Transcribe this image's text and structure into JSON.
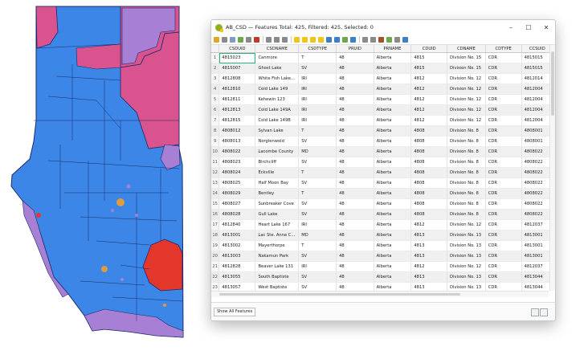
{
  "window": {
    "title": "AB_CSD — Features Total: 425, Filtered: 425, Selected: 0",
    "minimize": "–",
    "maximize": "☐",
    "close": "✕"
  },
  "toolbar": {
    "icons": [
      "pencil-icon",
      "edit-icon",
      "save-icon",
      "reload-icon",
      "add-feature-icon",
      "delete-icon",
      "cut-icon",
      "copy-icon",
      "paste-icon",
      "select-expression-icon",
      "select-all-icon",
      "invert-selection-icon",
      "deselect-icon",
      "filter-icon",
      "move-selection-top-icon",
      "pan-to-selection-icon",
      "zoom-to-selection-icon",
      "new-field-icon",
      "delete-field-icon",
      "field-calculator-icon",
      "conditional-format-icon",
      "actions-icon",
      "dock-icon"
    ]
  },
  "table": {
    "columns": [
      "CSDUID",
      "CSDNAME",
      "CSDTYPE",
      "PRUID",
      "PRNAME",
      "CDUID",
      "CDNAME",
      "CDTYPE",
      "CCSUID"
    ],
    "rows": [
      [
        "1",
        "4815023",
        "Canmore",
        "T",
        "48",
        "Alberta",
        "4815",
        "Division No. 15",
        "CDR",
        "4815015"
      ],
      [
        "2",
        "4815007",
        "Ghost Lake",
        "SV",
        "48",
        "Alberta",
        "4815",
        "Division No. 15",
        "CDR",
        "4815015"
      ],
      [
        "3",
        "4812808",
        "White Fish Lake...",
        "IRI",
        "48",
        "Alberta",
        "4812",
        "Division No. 12",
        "CDR",
        "4812014"
      ],
      [
        "4",
        "4812810",
        "Cold Lake 149",
        "IRI",
        "48",
        "Alberta",
        "4812",
        "Division No. 12",
        "CDR",
        "4812004"
      ],
      [
        "5",
        "4812811",
        "Kehewin 123",
        "IRI",
        "48",
        "Alberta",
        "4812",
        "Division No. 12",
        "CDR",
        "4812004"
      ],
      [
        "6",
        "4812813",
        "Cold Lake 149A",
        "IRI",
        "48",
        "Alberta",
        "4812",
        "Division No. 12",
        "CDR",
        "4812004"
      ],
      [
        "7",
        "4812815",
        "Cold Lake 149B",
        "IRI",
        "48",
        "Alberta",
        "4812",
        "Division No. 12",
        "CDR",
        "4812004"
      ],
      [
        "8",
        "4808012",
        "Sylvan Lake",
        "T",
        "48",
        "Alberta",
        "4808",
        "Division No.  8",
        "CDR",
        "4808001"
      ],
      [
        "9",
        "4808013",
        "Norglenwold",
        "SV",
        "48",
        "Alberta",
        "4808",
        "Division No.  8",
        "CDR",
        "4808001"
      ],
      [
        "10",
        "4808022",
        "Lacombe County",
        "MD",
        "48",
        "Alberta",
        "4808",
        "Division No.  8",
        "CDR",
        "4808022"
      ],
      [
        "11",
        "4808023",
        "Birchcliff",
        "SV",
        "48",
        "Alberta",
        "4808",
        "Division No.  8",
        "CDR",
        "4808022"
      ],
      [
        "12",
        "4808024",
        "Eckville",
        "T",
        "48",
        "Alberta",
        "4808",
        "Division No.  8",
        "CDR",
        "4808022"
      ],
      [
        "13",
        "4808025",
        "Half Moon Bay",
        "SV",
        "48",
        "Alberta",
        "4808",
        "Division No.  8",
        "CDR",
        "4808022"
      ],
      [
        "14",
        "4808029",
        "Bentley",
        "T",
        "48",
        "Alberta",
        "4808",
        "Division No.  8",
        "CDR",
        "4808022"
      ],
      [
        "15",
        "4808027",
        "Sunbreaker Cove",
        "SV",
        "48",
        "Alberta",
        "4808",
        "Division No.  8",
        "CDR",
        "4808022"
      ],
      [
        "16",
        "4808028",
        "Gull Lake",
        "SV",
        "48",
        "Alberta",
        "4808",
        "Division No.  8",
        "CDR",
        "4808022"
      ],
      [
        "17",
        "4812840",
        "Heart Lake 167",
        "IRI",
        "48",
        "Alberta",
        "4812",
        "Division No. 12",
        "CDR",
        "4812037"
      ],
      [
        "18",
        "4813001",
        "Lac Ste. Anne C...",
        "MD",
        "48",
        "Alberta",
        "4813",
        "Division No. 13",
        "CDR",
        "4813001"
      ],
      [
        "19",
        "4813002",
        "Mayerthorpe",
        "T",
        "48",
        "Alberta",
        "4813",
        "Division No. 13",
        "CDR",
        "4813001"
      ],
      [
        "20",
        "4813003",
        "Nakamun Park",
        "SV",
        "48",
        "Alberta",
        "4813",
        "Division No. 13",
        "CDR",
        "4813001"
      ],
      [
        "21",
        "4812828",
        "Beaver Lake 131",
        "IRI",
        "48",
        "Alberta",
        "4812",
        "Division No. 12",
        "CDR",
        "4812037"
      ],
      [
        "22",
        "4813055",
        "South Baptiste",
        "SV",
        "48",
        "Alberta",
        "4813",
        "Division No. 13",
        "CDR",
        "4813044"
      ],
      [
        "23",
        "4813057",
        "West Baptiste",
        "SV",
        "48",
        "Alberta",
        "4813",
        "Division No. 13",
        "CDR",
        "4813044"
      ]
    ]
  },
  "status": {
    "show_all": "Show All Features"
  },
  "colors": {
    "map_blue": "#3b86e6",
    "map_pink": "#d9548e",
    "map_purple": "#a77fd4",
    "map_red": "#e4372c",
    "map_orange": "#e09b3c",
    "selected_cell": "#2db37a"
  }
}
